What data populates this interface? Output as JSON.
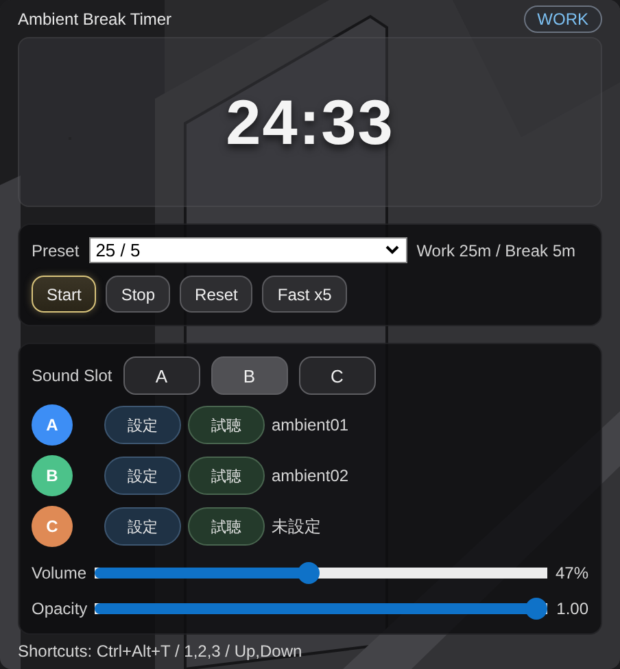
{
  "window": {
    "title": "Ambient Break Timer",
    "mode_badge": "WORK"
  },
  "timer": {
    "time": "24:33"
  },
  "preset": {
    "label": "Preset",
    "value": "25 / 5",
    "summary": "Work 25m / Break 5m"
  },
  "controls": [
    {
      "label": "Start",
      "selected": true
    },
    {
      "label": "Stop",
      "selected": false
    },
    {
      "label": "Reset",
      "selected": false
    },
    {
      "label": "Fast x5",
      "selected": false
    }
  ],
  "sound_slot": {
    "label": "Sound Slot",
    "options": [
      {
        "label": "A",
        "selected": false
      },
      {
        "label": "B",
        "selected": true
      },
      {
        "label": "C",
        "selected": false
      }
    ]
  },
  "slots": [
    {
      "badge": "A",
      "color": "#3d8ef5",
      "set_button": "設定",
      "preview_button": "試聴",
      "file": "ambient01"
    },
    {
      "badge": "B",
      "color": "#4cc28a",
      "set_button": "設定",
      "preview_button": "試聴",
      "file": "ambient02"
    },
    {
      "badge": "C",
      "color": "#df8a55",
      "set_button": "設定",
      "preview_button": "試聴",
      "file": "未設定"
    }
  ],
  "sliders": [
    {
      "label": "Volume",
      "level": 0.47,
      "reading": "47%"
    },
    {
      "label": "Opacity",
      "level": 1.0,
      "reading": "1.00"
    }
  ],
  "status_bar": "Shortcuts: Ctrl+Alt+T / 1,2,3 / Up,Down"
}
